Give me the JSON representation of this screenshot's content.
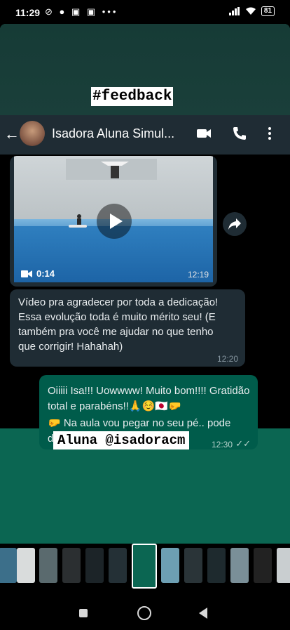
{
  "status_bar": {
    "time": "11:29",
    "left_icons": "⊘ ● ▣ ▣ •••",
    "battery": "81"
  },
  "story": {
    "hashtag": "#feedback",
    "caption": "Aluna @isadoracm"
  },
  "chat": {
    "contact_name": "Isadora Aluna Simul...",
    "video": {
      "duration": "0:14",
      "time": "12:19"
    },
    "incoming": {
      "text": "Vídeo pra agradecer por toda a dedicação! Essa evolução toda é muito mérito seu! (E também pra você me ajudar no que tenho que corrigir! Hahahah)",
      "time": "12:20"
    },
    "outgoing": {
      "line1": "Oiiiii Isa!!! Uowwww! Muito bom!!!! Gratidão total e parabéns!!🙏☺️🇯🇵🤛",
      "line2": "🤛 Na aula vou pegar no seu pé.. pode deixar!",
      "time": "12:30",
      "ticks": "✓✓"
    }
  },
  "colors": {
    "story_bg": "#0b6652",
    "header_bg": "#1f2c34",
    "incoming_bubble": "#1f2c34",
    "outgoing_bubble": "#005c4b"
  }
}
